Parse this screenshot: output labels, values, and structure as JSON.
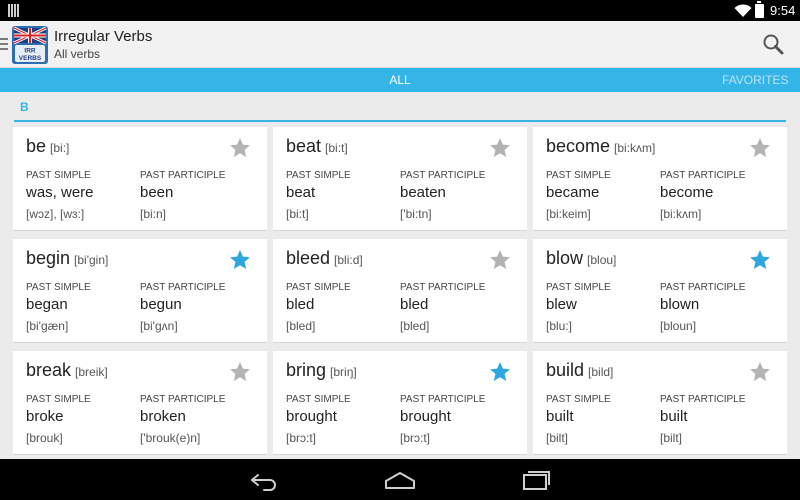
{
  "status": {
    "time": "9:54"
  },
  "app": {
    "title": "Irregular Verbs",
    "subtitle": "All verbs",
    "logo_text": "IRR VERBS"
  },
  "tabs": {
    "all": "ALL",
    "favorites": "FAVORITES"
  },
  "section": {
    "letter": "B"
  },
  "labels": {
    "past_simple": "PAST SIMPLE",
    "past_participle": "PAST PARTICIPLE"
  },
  "colors": {
    "accent": "#35b4e7",
    "star_on": "#2ea7e0",
    "star_off": "#b3b3b3"
  },
  "verbs": [
    {
      "verb": "be",
      "ipa": "[bi:]",
      "past_simple": "was, were",
      "past_participle": "been",
      "ps_ipa": "[wɔz], [wɜ:]",
      "pp_ipa": "[bi:n]",
      "favorite": false
    },
    {
      "verb": "beat",
      "ipa": "[bi:t]",
      "past_simple": "beat",
      "past_participle": "beaten",
      "ps_ipa": "[bi:t]",
      "pp_ipa": "['bi:tn]",
      "favorite": false
    },
    {
      "verb": "become",
      "ipa": "[bi:kʌm]",
      "past_simple": "became",
      "past_participle": "become",
      "ps_ipa": "[bi:keim]",
      "pp_ipa": "[bi:kʌm]",
      "favorite": false
    },
    {
      "verb": "begin",
      "ipa": "[bi'gin]",
      "past_simple": "began",
      "past_participle": "begun",
      "ps_ipa": "[bi'gæn]",
      "pp_ipa": "[bi'gʌn]",
      "favorite": true
    },
    {
      "verb": "bleed",
      "ipa": "[bli:d]",
      "past_simple": "bled",
      "past_participle": "bled",
      "ps_ipa": "[bled]",
      "pp_ipa": "[bled]",
      "favorite": false
    },
    {
      "verb": "blow",
      "ipa": "[blou]",
      "past_simple": "blew",
      "past_participle": "blown",
      "ps_ipa": "[blu:]",
      "pp_ipa": "[bloun]",
      "favorite": true
    },
    {
      "verb": "break",
      "ipa": "[breik]",
      "past_simple": "broke",
      "past_participle": "broken",
      "ps_ipa": "[brouk]",
      "pp_ipa": "['brouk(e)n]",
      "favorite": false
    },
    {
      "verb": "bring",
      "ipa": "[briŋ]",
      "past_simple": "brought",
      "past_participle": "brought",
      "ps_ipa": "[brɔ:t]",
      "pp_ipa": "[brɔ:t]",
      "favorite": true
    },
    {
      "verb": "build",
      "ipa": "[bild]",
      "past_simple": "built",
      "past_participle": "built",
      "ps_ipa": "[bilt]",
      "pp_ipa": "[bilt]",
      "favorite": false
    }
  ],
  "icons": {
    "search": "search-icon",
    "menu": "menu-icon",
    "star": "star-icon",
    "back": "back-icon",
    "home": "home-icon",
    "recents": "recent-apps-icon",
    "wifi": "wifi-icon",
    "battery": "battery-icon",
    "notification": "notification-icon"
  }
}
